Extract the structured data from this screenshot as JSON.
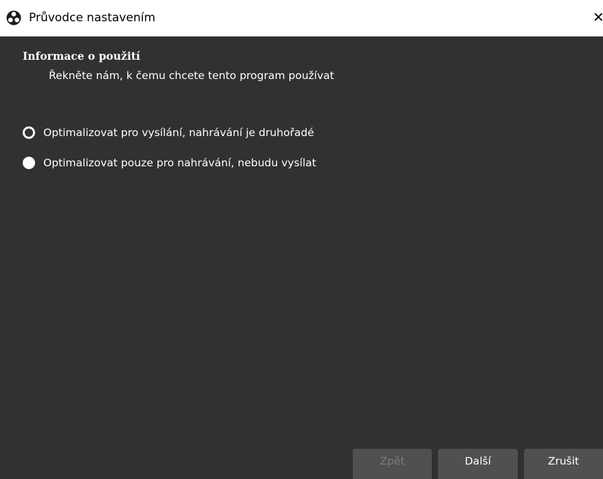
{
  "window": {
    "title": "Průvodce nastavením",
    "close_glyph": "✕"
  },
  "icons": {
    "app": "obs-logo-icon",
    "close": "close-icon"
  },
  "page": {
    "heading": "Informace o použití",
    "subheading": "Řekněte nám, k čemu chcete tento program používat"
  },
  "options": [
    {
      "label": "Optimalizovat pro vysílání, nahrávání je druhořadé",
      "selected": false
    },
    {
      "label": "Optimalizovat pouze pro nahrávání, nebudu vysílat",
      "selected": false
    }
  ],
  "buttons": {
    "back": "Zpět",
    "next": "Další",
    "cancel": "Zrušit"
  },
  "colors": {
    "background": "#313131",
    "titlebar": "#ffffff",
    "button": "#505050",
    "disabled_text": "#7d7d7d"
  }
}
